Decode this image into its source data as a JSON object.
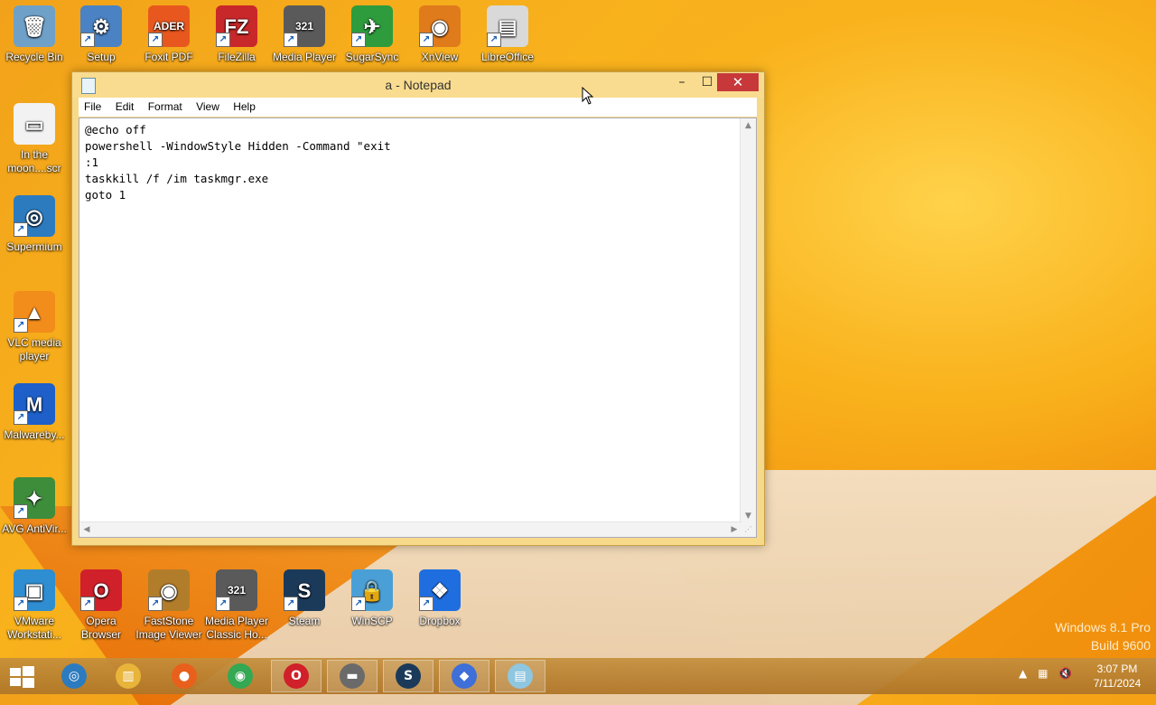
{
  "desktop": {
    "icons": [
      {
        "label": "Recycle Bin",
        "glyph": "🗑",
        "color": "#6fa0c8"
      },
      {
        "label": "Setup",
        "glyph": "⚙",
        "color": "#4a82c3"
      },
      {
        "label": "Foxit PDF",
        "glyph": "ADER",
        "color": "#e8581e"
      },
      {
        "label": "FileZilla",
        "glyph": "FZ",
        "color": "#c9282a"
      },
      {
        "label": "Media Player",
        "glyph": "321",
        "color": "#5a5a5a"
      },
      {
        "label": "SugarSync",
        "glyph": "✈",
        "color": "#2e9b3d"
      },
      {
        "label": "XnView",
        "glyph": "◉",
        "color": "#e07b1c"
      },
      {
        "label": "LibreOffice",
        "glyph": "▤",
        "color": "#d9d9d9"
      },
      {
        "label": "In the moon....scr",
        "glyph": "▭",
        "color": "#f2f2f2"
      },
      {
        "label": "Supermium",
        "glyph": "◎",
        "color": "#2d7bbf"
      },
      {
        "label": "VLC media player",
        "glyph": "▲",
        "color": "#f28c1a"
      },
      {
        "label": "Malwareby...",
        "glyph": "M",
        "color": "#1e5fc9"
      },
      {
        "label": "AVG AntiVir...",
        "glyph": "✦",
        "color": "#3e8d3b"
      },
      {
        "label": "VMware Workstati...",
        "glyph": "▣",
        "color": "#2f8dd1"
      },
      {
        "label": "Opera Browser",
        "glyph": "O",
        "color": "#d0202a"
      },
      {
        "label": "FastStone Image Viewer",
        "glyph": "◉",
        "color": "#b27d2a"
      },
      {
        "label": "Media Player Classic Ho...",
        "glyph": "321",
        "color": "#5a5a5a"
      },
      {
        "label": "Steam",
        "glyph": "S",
        "color": "#1b3a5a"
      },
      {
        "label": "WinSCP",
        "glyph": "🔒",
        "color": "#4aa0d6"
      },
      {
        "label": "Dropbox",
        "glyph": "❖",
        "color": "#1f6ee0"
      }
    ]
  },
  "notepad": {
    "title": "a - Notepad",
    "menu": [
      "File",
      "Edit",
      "Format",
      "View",
      "Help"
    ],
    "content": "@echo off\npowershell -WindowStyle Hidden -Command \"exit\n:1\ntaskkill /f /im taskmgr.exe\ngoto 1",
    "minimize": "–",
    "maximize": "☐",
    "close": "✕"
  },
  "watermark": {
    "line1": "Windows 8.1 Pro",
    "line2": "Build 9600"
  },
  "taskbar": {
    "apps": [
      {
        "name": "supermium",
        "glyph": "◎",
        "color": "#2d7bbf"
      },
      {
        "name": "file-explorer",
        "glyph": "▥",
        "color": "#e8b43a"
      },
      {
        "name": "firefox",
        "glyph": "●",
        "color": "#e8601c"
      },
      {
        "name": "chrome",
        "glyph": "◉",
        "color": "#34a853"
      },
      {
        "name": "opera",
        "glyph": "O",
        "color": "#d0202a"
      },
      {
        "name": "usb-tool",
        "glyph": "▬",
        "color": "#6a6a6a"
      },
      {
        "name": "steam",
        "glyph": "S",
        "color": "#1b3a5a"
      },
      {
        "name": "app-shell",
        "glyph": "◆",
        "color": "#3f6fd8"
      },
      {
        "name": "notepad",
        "glyph": "▤",
        "color": "#8fc6e0"
      }
    ],
    "clock_time": "3:07 PM",
    "clock_date": "7/11/2024"
  }
}
